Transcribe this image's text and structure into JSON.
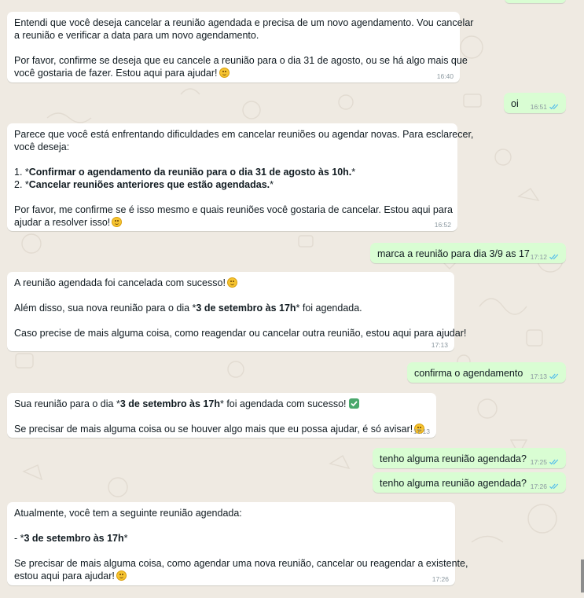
{
  "chat": {
    "messages": [
      {
        "id": "m1",
        "direction": "in",
        "time": "16:40",
        "lines": [
          "Entendi que você deseja cancelar a reunião agendada e precisa de um novo agendamento. Vou cancelar",
          "a reunião e verificar a data para um novo agendamento.",
          "",
          "Por favor, confirme se deseja que eu cancele a reunião para o dia 31 de agosto, ou se há algo mais que",
          "você gostaria de fazer. Estou aqui para ajudar!"
        ]
      },
      {
        "id": "m2",
        "direction": "out",
        "time": "16:51",
        "lines": [
          "oi"
        ],
        "status": "read"
      },
      {
        "id": "m3",
        "direction": "in",
        "time": "16:52",
        "lines": [
          "Parece que você está enfrentando dificuldades em cancelar reuniões ou agendar novas. Para esclarecer,",
          "você deseja:",
          "",
          "1. *",
          "Confirmar o agendamento da reunião para o dia 31 de agosto às 10h.",
          "*",
          "2. *",
          "Cancelar reuniões anteriores que estão agendadas.",
          "*",
          "",
          "Por favor, me confirme se é isso mesmo e quais reuniões você gostaria de cancelar. Estou aqui para",
          "ajudar a resolver isso!"
        ]
      },
      {
        "id": "m4",
        "direction": "out",
        "time": "17:12",
        "lines": [
          "marca a reunião para dia 3/9 as 17"
        ],
        "status": "read"
      },
      {
        "id": "m5",
        "direction": "in",
        "time": "17:13",
        "lines": [
          "A reunião agendada foi cancelada com sucesso!",
          "Além disso, sua nova reunião para o dia *",
          "3 de setembro às 17h",
          "* foi agendada.",
          "Caso precise de mais alguma coisa, como reagendar ou cancelar outra reunião, estou aqui para ajudar!"
        ]
      },
      {
        "id": "m6",
        "direction": "out",
        "time": "17:13",
        "lines": [
          "confirma o agendamento"
        ],
        "status": "read"
      },
      {
        "id": "m7",
        "direction": "in",
        "time": "17:13",
        "lines": [
          "Sua reunião para o dia *",
          "3 de setembro às 17h",
          "* foi agendada com sucesso!",
          "Se precisar de mais alguma coisa ou se houver algo mais que eu possa ajudar, é só avisar!"
        ]
      },
      {
        "id": "m8",
        "direction": "out",
        "time": "17:25",
        "lines": [
          "tenho alguma reunião agendada?"
        ],
        "status": "read"
      },
      {
        "id": "m9",
        "direction": "out",
        "time": "17:26",
        "lines": [
          "tenho alguma reunião agendada?"
        ],
        "status": "read"
      },
      {
        "id": "m10",
        "direction": "in",
        "time": "17:26",
        "lines": [
          "Atualmente, você tem a seguinte reunião agendada:",
          "- *",
          "3 de setembro às 17h",
          "*",
          "Se precisar de mais alguma coisa, como agendar uma nova reunião, cancelar ou reagendar a existente,",
          "estou aqui para ajudar!"
        ]
      }
    ]
  },
  "colors": {
    "background": "#efeae2",
    "incoming_bubble": "#ffffff",
    "outgoing_bubble": "#d9fdd3",
    "read_ticks": "#53bdeb",
    "text": "#111b21",
    "timestamp": "#8a979f"
  },
  "icons": {
    "smile": "smiling-face-emoji",
    "check": "white-check-mark-emoji",
    "ticks": "double-check-icon"
  }
}
